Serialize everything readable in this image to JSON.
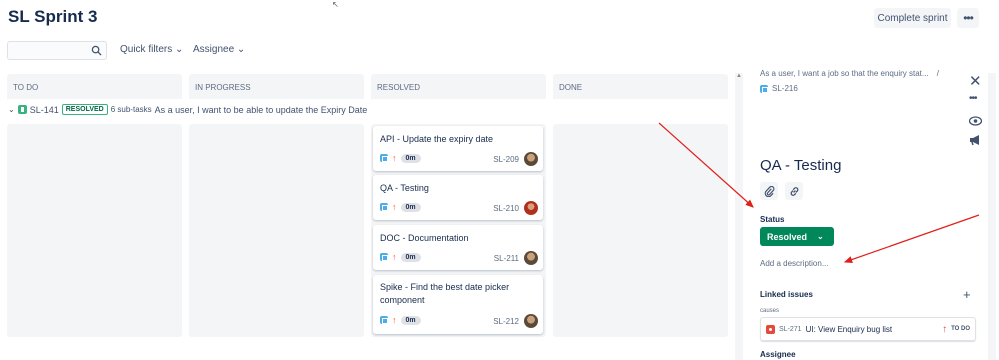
{
  "header": {
    "title": "SL Sprint 3",
    "complete_sprint": "Complete sprint",
    "more": "•••"
  },
  "toolbar": {
    "search_value": "",
    "quick_filters": "Quick filters",
    "assignee": "Assignee"
  },
  "columns": [
    "TO DO",
    "IN PROGRESS",
    "RESOLVED",
    "DONE"
  ],
  "swimlane": {
    "key": "SL-141",
    "status": "RESOLVED",
    "subtasks": "6 sub-tasks",
    "summary": "As a user, I want to be able to update the Expiry Date"
  },
  "cards": [
    {
      "summary": "API - Update the expiry date",
      "estimate": "0m",
      "key": "SL-209"
    },
    {
      "summary": "QA - Testing",
      "estimate": "0m",
      "key": "SL-210"
    },
    {
      "summary": "DOC - Documentation",
      "estimate": "0m",
      "key": "SL-211"
    },
    {
      "summary": "Spike - Find the best date picker component",
      "estimate": "0m",
      "key": "SL-212"
    }
  ],
  "detail": {
    "parent_summary": "As a user, I want a job so that the enquiry stat...",
    "separator": "/",
    "key": "SL-216",
    "title": "QA - Testing",
    "status_label": "Status",
    "status_value": "Resolved",
    "description_placeholder": "Add a description...",
    "linked_issues_label": "Linked issues",
    "causes_label": "causes",
    "linked_issue": {
      "key": "SL-271",
      "summary": "UI: View Enquiry bug list",
      "status": "TO DO"
    },
    "assignee_label": "Assignee"
  },
  "colors": {
    "accent": "#0052cc",
    "resolved": "#00875a",
    "annotation": "#e0201b"
  }
}
